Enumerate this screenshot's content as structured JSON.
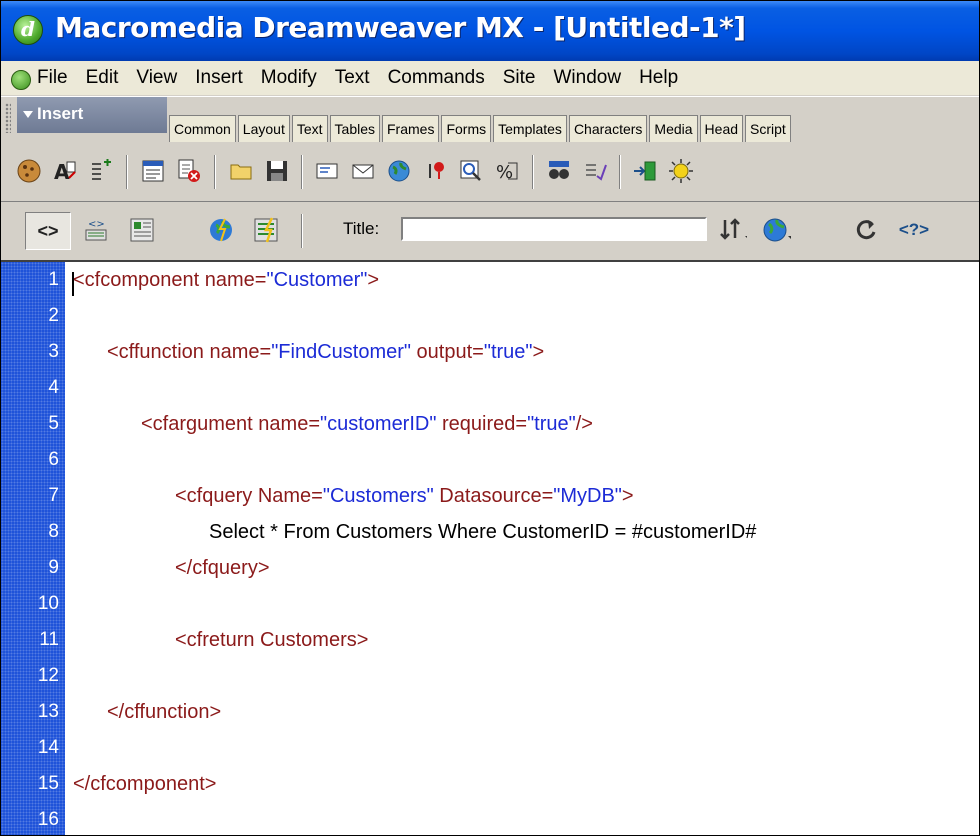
{
  "window": {
    "title": "Macromedia Dreamweaver MX - [Untitled-1*]"
  },
  "menu": [
    "File",
    "Edit",
    "View",
    "Insert",
    "Modify",
    "Text",
    "Commands",
    "Site",
    "Window",
    "Help"
  ],
  "insert_bar": {
    "title": "Insert",
    "tabs": [
      "Common",
      "Layout",
      "Text",
      "Tables",
      "Frames",
      "Forms",
      "Templates",
      "Characters",
      "Media",
      "Head",
      "Script"
    ]
  },
  "icon_toolbar": {
    "icons": [
      "cookie-icon",
      "font-edit-icon",
      "insert-tag-icon",
      "form-icon",
      "delete-record-icon",
      "open-folder-icon",
      "save-icon",
      "mail-icon",
      "email-icon",
      "globe-icon",
      "map-pin-icon",
      "search-icon",
      "formula-icon",
      "binoculars-icon",
      "check-list-icon",
      "import-icon",
      "sun-icon"
    ]
  },
  "doc_toolbar": {
    "title_label": "Title:",
    "title_value": ""
  },
  "editor": {
    "line_numbers": [
      "1",
      "2",
      "3",
      "4",
      "5",
      "6",
      "7",
      "8",
      "9",
      "10",
      "11",
      "12",
      "13",
      "14",
      "15",
      "16"
    ],
    "lines": [
      {
        "indent": 0,
        "parts": [
          {
            "t": "tag",
            "s": "<cfcomponent name="
          },
          {
            "t": "val",
            "s": "\"Customer\""
          },
          {
            "t": "tag",
            "s": ">"
          }
        ]
      },
      {
        "indent": 0,
        "parts": []
      },
      {
        "indent": 1,
        "parts": [
          {
            "t": "tag",
            "s": "<cffunction name="
          },
          {
            "t": "val",
            "s": "\"FindCustomer\""
          },
          {
            "t": "tag",
            "s": " output="
          },
          {
            "t": "val",
            "s": "\"true\""
          },
          {
            "t": "tag",
            "s": ">"
          }
        ]
      },
      {
        "indent": 0,
        "parts": []
      },
      {
        "indent": 2,
        "parts": [
          {
            "t": "tag",
            "s": "<cfargument name="
          },
          {
            "t": "val",
            "s": "\"customerID\""
          },
          {
            "t": "tag",
            "s": " required="
          },
          {
            "t": "val",
            "s": "\"true\""
          },
          {
            "t": "tag",
            "s": "/>"
          }
        ]
      },
      {
        "indent": 0,
        "parts": []
      },
      {
        "indent": 3,
        "parts": [
          {
            "t": "tag",
            "s": "<cfquery Name="
          },
          {
            "t": "val",
            "s": "\"Customers\""
          },
          {
            "t": "tag",
            "s": " Datasource="
          },
          {
            "t": "val",
            "s": "\"MyDB\""
          },
          {
            "t": "tag",
            "s": ">"
          }
        ]
      },
      {
        "indent": 4,
        "parts": [
          {
            "t": "plain",
            "s": "Select * From Customers Where CustomerID = #customerID#"
          }
        ]
      },
      {
        "indent": 3,
        "parts": [
          {
            "t": "tag",
            "s": "</cfquery>"
          }
        ]
      },
      {
        "indent": 0,
        "parts": []
      },
      {
        "indent": 3,
        "parts": [
          {
            "t": "tag",
            "s": "<cfreturn Customers>"
          }
        ]
      },
      {
        "indent": 0,
        "parts": []
      },
      {
        "indent": 1,
        "parts": [
          {
            "t": "tag",
            "s": "</cffunction>"
          }
        ]
      },
      {
        "indent": 0,
        "parts": []
      },
      {
        "indent": 0,
        "parts": [
          {
            "t": "tag",
            "s": "</cfcomponent>"
          }
        ]
      },
      {
        "indent": 0,
        "parts": []
      }
    ]
  },
  "colors": {
    "tag": "#8b1a1a",
    "value": "#1c2bd6",
    "gutter": "#1a4fd8",
    "titlebar": "#0054e3"
  }
}
